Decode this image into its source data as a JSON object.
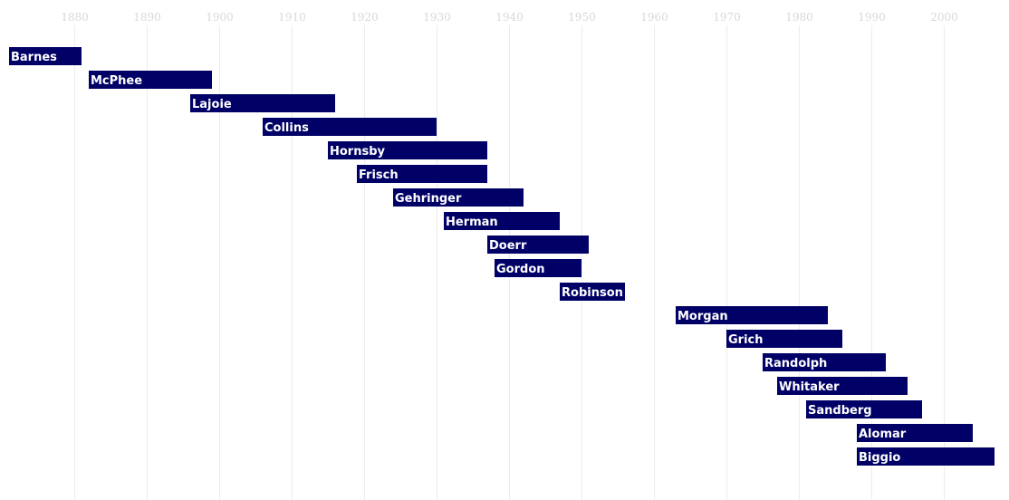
{
  "chart_data": {
    "type": "bar",
    "orientation": "horizontal-range",
    "title": "",
    "xlabel": "",
    "ylabel": "",
    "xlim": [
      1870,
      2009
    ],
    "grid": true,
    "x_ticks": [
      1880,
      1890,
      1900,
      1910,
      1920,
      1930,
      1940,
      1950,
      1960,
      1970,
      1980,
      1990,
      2000
    ],
    "tick_labels": [
      "1880",
      "1890",
      "1900",
      "1910",
      "1920",
      "1930",
      "1940",
      "1950",
      "1960",
      "1970",
      "1980",
      "1990",
      "2000"
    ],
    "bar_color": "#000066",
    "label_color": "#ffffff",
    "series": [
      {
        "name": "Barnes",
        "start": 1871,
        "end": 1881
      },
      {
        "name": "McPhee",
        "start": 1882,
        "end": 1899
      },
      {
        "name": "Lajoie",
        "start": 1896,
        "end": 1916
      },
      {
        "name": "Collins",
        "start": 1906,
        "end": 1930
      },
      {
        "name": "Hornsby",
        "start": 1915,
        "end": 1937
      },
      {
        "name": "Frisch",
        "start": 1919,
        "end": 1937
      },
      {
        "name": "Gehringer",
        "start": 1924,
        "end": 1942
      },
      {
        "name": "Herman",
        "start": 1931,
        "end": 1947
      },
      {
        "name": "Doerr",
        "start": 1937,
        "end": 1951
      },
      {
        "name": "Gordon",
        "start": 1938,
        "end": 1950
      },
      {
        "name": "Robinson",
        "start": 1947,
        "end": 1956
      },
      {
        "name": "Morgan",
        "start": 1963,
        "end": 1984
      },
      {
        "name": "Grich",
        "start": 1970,
        "end": 1986
      },
      {
        "name": "Randolph",
        "start": 1975,
        "end": 1992
      },
      {
        "name": "Whitaker",
        "start": 1977,
        "end": 1995
      },
      {
        "name": "Sandberg",
        "start": 1981,
        "end": 1997
      },
      {
        "name": "Alomar",
        "start": 1988,
        "end": 2004
      },
      {
        "name": "Biggio",
        "start": 1988,
        "end": 2007
      }
    ]
  }
}
